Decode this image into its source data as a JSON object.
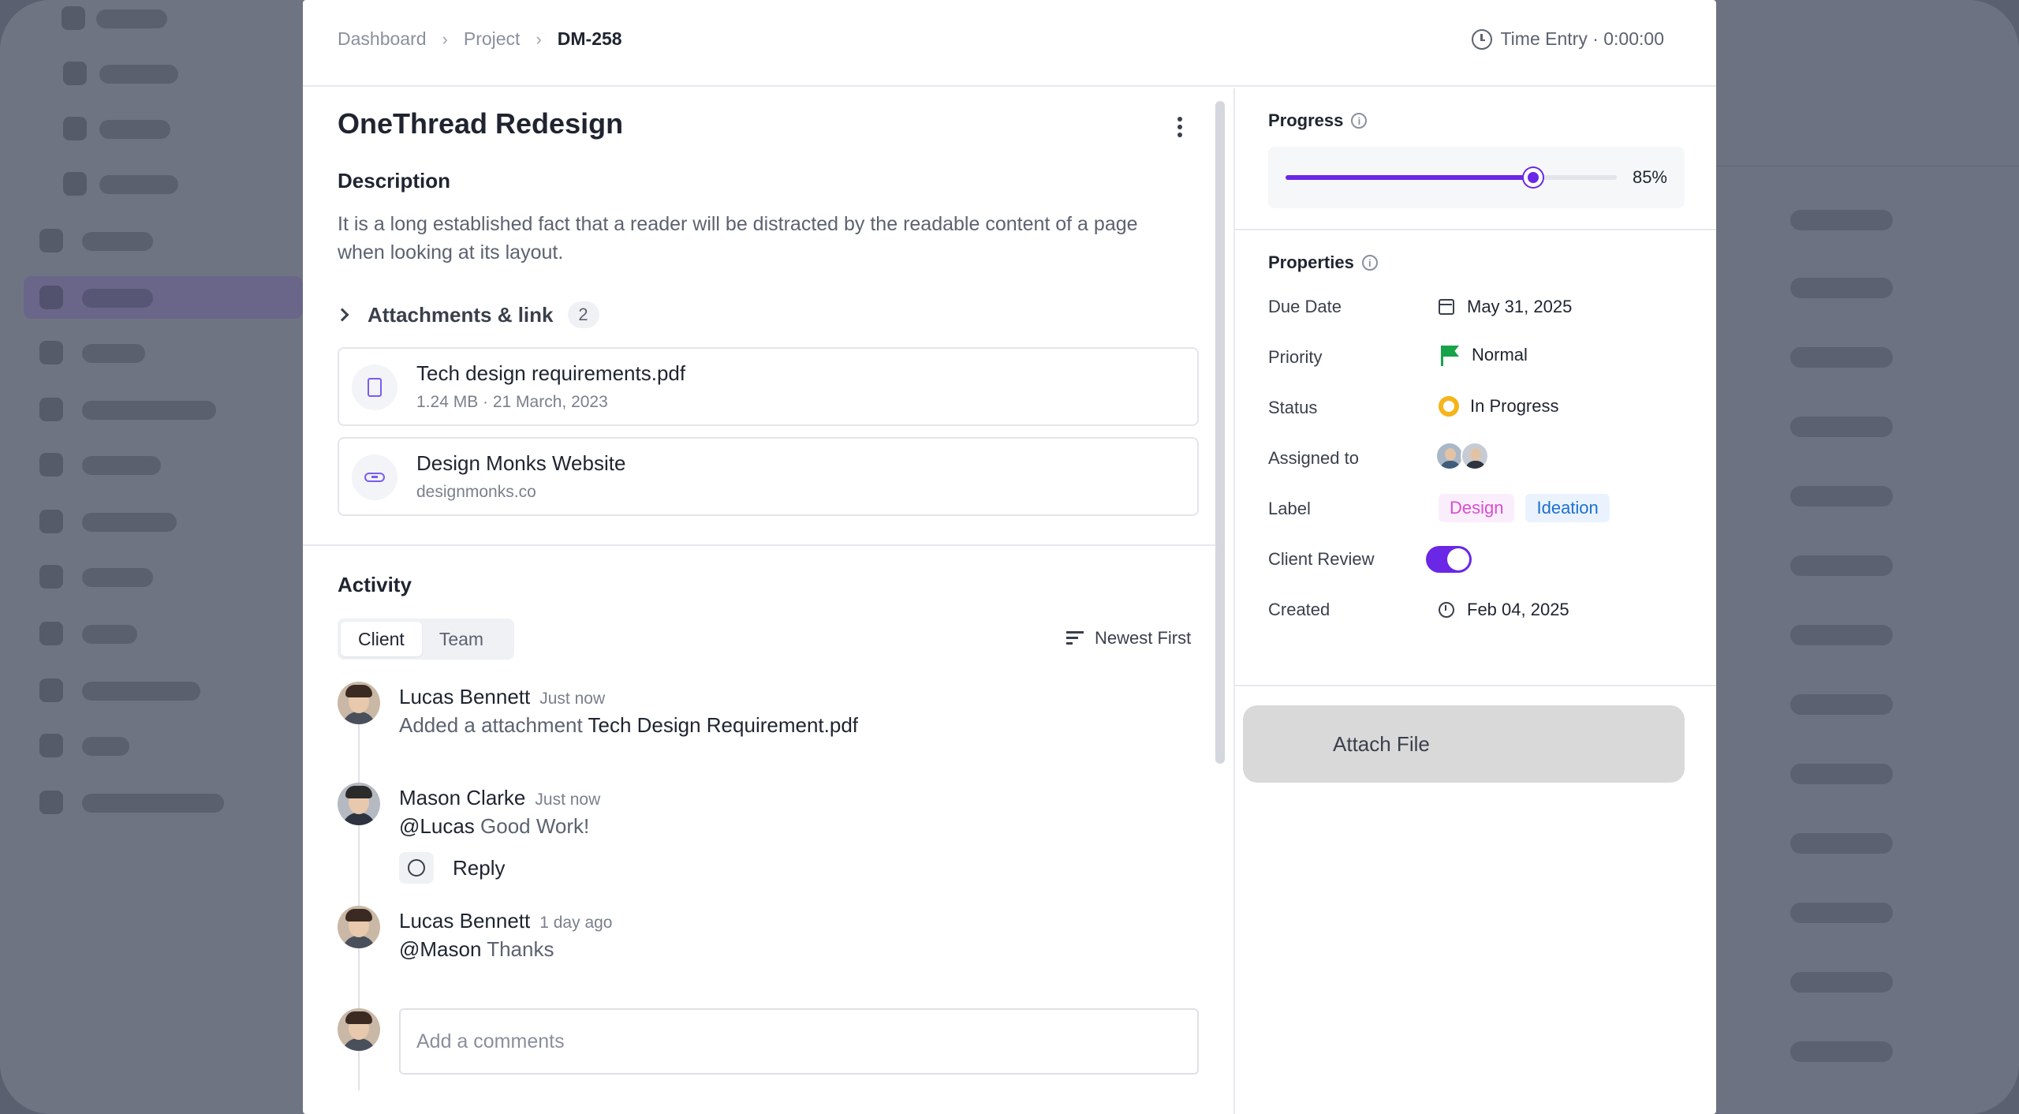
{
  "breadcrumb": [
    {
      "label": "Dashboard"
    },
    {
      "label": "Project"
    },
    {
      "label": "DM-258"
    }
  ],
  "time_entry": "Time Entry · 0:00:00",
  "task": {
    "title": "OneThread Redesign",
    "description_heading": "Description",
    "description": "It is a long established fact that a reader will be distracted by the readable content of a page when looking at its layout."
  },
  "attachments": {
    "label": "Attachments & link",
    "count": "2",
    "items": [
      {
        "name": "Tech design requirements.pdf",
        "meta": "1.24 MB · 21 March, 2023",
        "icon": "file-icon"
      },
      {
        "name": "Design Monks Website",
        "meta": "designmonks.co",
        "icon": "link-icon"
      }
    ]
  },
  "activity": {
    "heading": "Activity",
    "tabs": [
      {
        "label": "Client",
        "active": true
      },
      {
        "label": "Team",
        "active": false
      }
    ],
    "sort_label": "Newest First",
    "comments": [
      {
        "author": "Lucas Bennett",
        "time": "Just now",
        "prefix": "Added a attachment",
        "highlight": "Tech Design Requirement.pdf"
      },
      {
        "author": "Mason Clarke",
        "time": "Just now",
        "mention": "@Lucas",
        "text": "Good Work!"
      },
      {
        "author": "Lucas Bennett",
        "time": "1 day ago",
        "mention": "@Mason",
        "text": "Thanks"
      }
    ],
    "reply_label": "Reply",
    "comment_placeholder": "Add a comments"
  },
  "progress": {
    "label": "Progress",
    "value": 85,
    "value_label": "85%"
  },
  "properties": {
    "label": "Properties",
    "due_date": {
      "label": "Due Date",
      "value": "May 31, 2025"
    },
    "priority": {
      "label": "Priority",
      "value": "Normal",
      "color": "#17a34a"
    },
    "status": {
      "label": "Status",
      "value": "In Progress",
      "color": "#f5b419"
    },
    "assigned_to": {
      "label": "Assigned to"
    },
    "labels": {
      "label": "Label",
      "tags": [
        "Design",
        "Ideation"
      ]
    },
    "client_review": {
      "label": "Client Review",
      "enabled": true
    },
    "created": {
      "label": "Created",
      "value": "Feb 04, 2025"
    }
  },
  "attach_file_label": "Attach File",
  "colors": {
    "accent": "#6a27e6"
  }
}
